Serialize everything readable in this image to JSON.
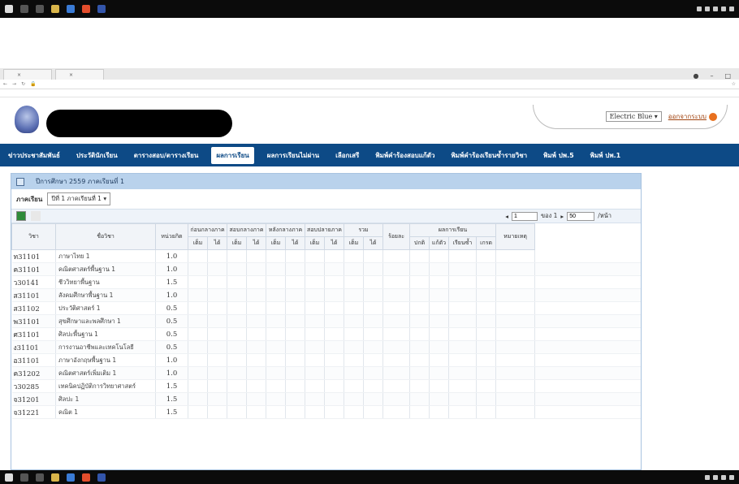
{
  "browser": {
    "tabs": [
      "",
      ""
    ],
    "address": "",
    "bookmarks": [
      "",
      "",
      "",
      "",
      "",
      ""
    ]
  },
  "header": {
    "theme": "Electric Blue",
    "logout_label": "ออกจากระบบ"
  },
  "nav": {
    "items": [
      {
        "label": "ข่าวประชาสัมพันธ์",
        "active": false
      },
      {
        "label": "ประวัตินักเรียน",
        "active": false
      },
      {
        "label": "ตารางสอบ/ตารางเรียน",
        "active": false
      },
      {
        "label": "ผลการเรียน",
        "active": true
      },
      {
        "label": "ผลการเรียนไม่ผ่าน",
        "active": false
      },
      {
        "label": "เลือกเสรี",
        "active": false
      },
      {
        "label": "พิมพ์คำร้องสอบแก้ตัว",
        "active": false
      },
      {
        "label": "พิมพ์คำร้องเรียนซ้ำรายวิชา",
        "active": false
      },
      {
        "label": "พิมพ์ ปพ.5",
        "active": false
      },
      {
        "label": "พิมพ์ ปพ.1",
        "active": false
      }
    ]
  },
  "panel": {
    "title": "ปีการศึกษา 2559 ภาคเรียนที่ 1",
    "term_label": "ภาคเรียน",
    "term_value": "ปีที่ 1 ภาคเรียนที่ 1",
    "page_value": "1",
    "page_of": "ของ 1",
    "page_size": "50",
    "per_page_label": "/หน้า"
  },
  "table": {
    "headers": {
      "code": "วิชา",
      "name": "ชื่อวิชา",
      "credit": "หน่วยกิต",
      "groups": [
        "ก่อนกลางภาค",
        "สอบกลางภาค",
        "หลังกลางภาค",
        "สอบปลายภาค",
        "รวม"
      ],
      "sub_full": "เต็ม",
      "sub_got": "ได้",
      "percent": "ร้อยละ",
      "result_group": "ผลการเรียน",
      "result_cols": [
        "ปกติ",
        "แก้ตัว",
        "เรียนซ้ำ",
        "เกรด"
      ],
      "note": "หมายเหตุ"
    },
    "rows": [
      {
        "code": "ท31101",
        "name": "ภาษาไทย 1",
        "credit": "1.0"
      },
      {
        "code": "ค31101",
        "name": "คณิตศาสตร์พื้นฐาน 1",
        "credit": "1.0"
      },
      {
        "code": "ว30141",
        "name": "ชีววิทยาพื้นฐาน",
        "credit": "1.5"
      },
      {
        "code": "ส31101",
        "name": "สังคมศึกษาพื้นฐาน 1",
        "credit": "1.0"
      },
      {
        "code": "ส31102",
        "name": "ประวัติศาสตร์ 1",
        "credit": "0.5"
      },
      {
        "code": "พ31101",
        "name": "สุขศึกษาและพลศึกษา 1",
        "credit": "0.5"
      },
      {
        "code": "ศ31101",
        "name": "ศิลปะพื้นฐาน 1",
        "credit": "0.5"
      },
      {
        "code": "ง31101",
        "name": "การงานอาชีพและเทคโนโลยี",
        "credit": "0.5"
      },
      {
        "code": "อ31101",
        "name": "ภาษาอังกฤษพื้นฐาน 1",
        "credit": "1.0"
      },
      {
        "code": "ค31202",
        "name": "คณิตศาสตร์เพิ่มเติม 1",
        "credit": "1.0"
      },
      {
        "code": "ว30285",
        "name": "เทคนิคปฏิบัติการวิทยาศาสตร์",
        "credit": "1.5"
      },
      {
        "code": "จ31201",
        "name": "ศิลปะ 1",
        "credit": "1.5"
      },
      {
        "code": "จ31221",
        "name": "คณิต 1",
        "credit": "1.5"
      }
    ]
  }
}
